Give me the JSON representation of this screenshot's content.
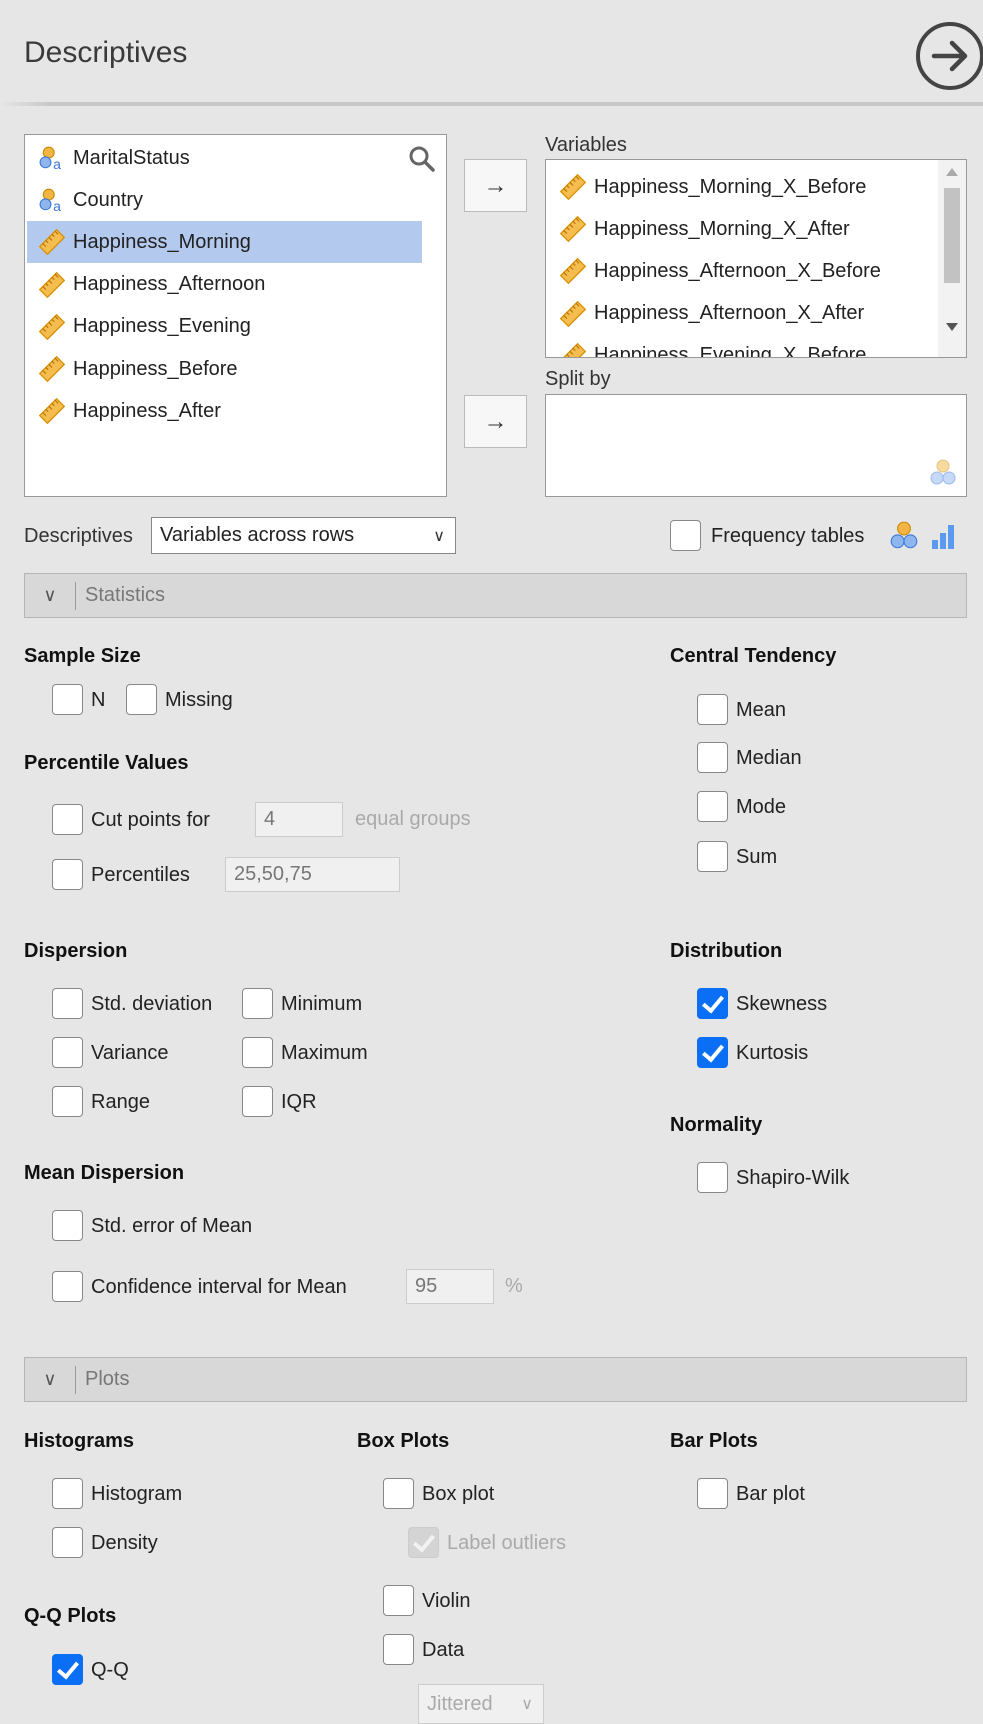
{
  "title": "Descriptives",
  "source_vars": [
    {
      "label": "MaritalStatus",
      "type": "nominal-text",
      "icon": "nominal-text-icon"
    },
    {
      "label": "Country",
      "type": "nominal-text",
      "icon": "nominal-text-icon"
    },
    {
      "label": "Happiness_Morning",
      "type": "continuous",
      "icon": "ruler-icon",
      "selected": true
    },
    {
      "label": "Happiness_Afternoon",
      "type": "continuous",
      "icon": "ruler-icon"
    },
    {
      "label": "Happiness_Evening",
      "type": "continuous",
      "icon": "ruler-icon"
    },
    {
      "label": "Happiness_Before",
      "type": "continuous",
      "icon": "ruler-icon"
    },
    {
      "label": "Happiness_After",
      "type": "continuous",
      "icon": "ruler-icon"
    }
  ],
  "variables_label": "Variables",
  "variables": [
    "Happiness_Morning_X_Before",
    "Happiness_Morning_X_After",
    "Happiness_Afternoon_X_Before",
    "Happiness_Afternoon_X_After",
    "Happiness_Evening_X_Before"
  ],
  "split_label": "Split by",
  "move_arrow": "→",
  "desc_label": "Descriptives",
  "desc_select": "Variables across rows",
  "freq_label": "Frequency tables",
  "statistics": {
    "header": "Statistics",
    "sample_size": "Sample Size",
    "n": "N",
    "missing": "Missing",
    "percentile_values": "Percentile Values",
    "cut_points": "Cut points for",
    "cut_value": "4",
    "equal_groups": "equal groups",
    "percentiles": "Percentiles",
    "percentiles_value": "25,50,75",
    "dispersion": "Dispersion",
    "std": "Std. deviation",
    "variance": "Variance",
    "range": "Range",
    "minimum": "Minimum",
    "maximum": "Maximum",
    "iqr": "IQR",
    "mean_dispersion": "Mean Dispersion",
    "se": "Std. error of Mean",
    "ci": "Confidence interval for Mean",
    "ci_value": "95",
    "pct": "%",
    "central": "Central Tendency",
    "mean": "Mean",
    "median": "Median",
    "mode": "Mode",
    "sum": "Sum",
    "distribution": "Distribution",
    "skewness": "Skewness",
    "kurtosis": "Kurtosis",
    "normality": "Normality",
    "shapiro": "Shapiro-Wilk"
  },
  "checked": {
    "skewness": true,
    "kurtosis": true,
    "qq": true,
    "label_outliers": true
  },
  "plots": {
    "header": "Plots",
    "histograms": "Histograms",
    "histogram": "Histogram",
    "density": "Density",
    "qq_plots": "Q-Q Plots",
    "qq": "Q-Q",
    "box_plots": "Box Plots",
    "box_plot": "Box plot",
    "label_outliers": "Label outliers",
    "violin": "Violin",
    "data": "Data",
    "data_select": "Jittered",
    "bar_plots": "Bar Plots",
    "bar_plot": "Bar plot"
  },
  "colors": {
    "accent": "#0b6ff5",
    "selection": "#b4c9ee",
    "ruler": "#f0b400"
  }
}
